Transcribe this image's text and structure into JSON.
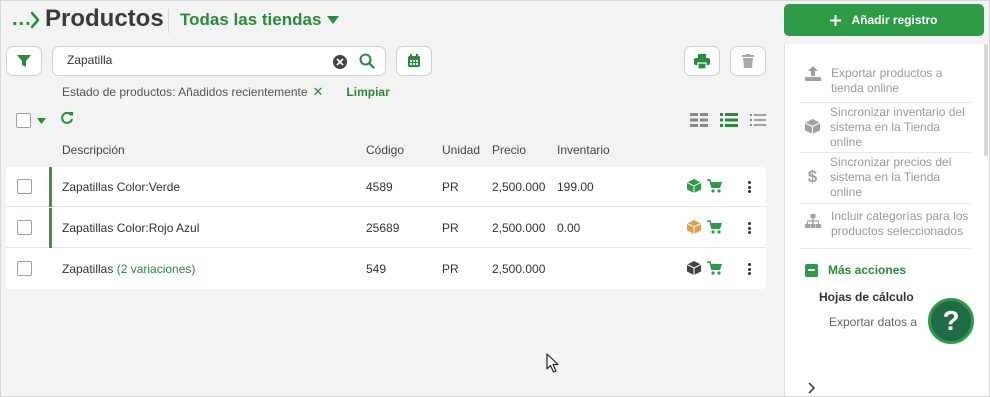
{
  "header": {
    "crumb_dots": "...",
    "title": "Productos",
    "store_selector": "Todas las tiendas"
  },
  "add_button": {
    "label": "Añadir registro"
  },
  "search": {
    "value": "Zapatilla",
    "placeholder": ""
  },
  "filter": {
    "text": "Estado de productos: Añadidos recientemente",
    "remove": "✕",
    "clear_label": "Limpiar"
  },
  "table": {
    "columns": [
      "Descripción",
      "Código",
      "Unidad",
      "Precio",
      "Inventario"
    ],
    "rows": [
      {
        "description": "Zapatillas Color:Verde",
        "variations": "",
        "code": "4589",
        "unit": "PR",
        "price": "2,500.000",
        "inventory": "199.00",
        "box_color": "#2e9b47"
      },
      {
        "description": "Zapatillas Color:Rojo Azul",
        "variations": "",
        "code": "25689",
        "unit": "PR",
        "price": "2,500.000",
        "inventory": "0.00",
        "box_color": "#e0a052"
      },
      {
        "description": "Zapatillas",
        "variations": "(2 variaciones)",
        "code": "549",
        "unit": "PR",
        "price": "2,500.000",
        "inventory": "",
        "box_color": "#444444"
      }
    ]
  },
  "panel": {
    "items": [
      {
        "label": "Exportar productos a tienda online",
        "icon": "upload-icon"
      },
      {
        "label": "Sincronizar inventario del sistema en la Tienda online",
        "icon": "box-icon"
      },
      {
        "label": "Sincronizar precios del sistema en la Tienda online",
        "icon": "dollar-icon"
      },
      {
        "label": "Incluir categorías para los productos seleccionados",
        "icon": "sitemap-icon"
      }
    ],
    "more_actions": "Más acciones",
    "spreadsheets": "Hojas de cálculo",
    "cut_item": "Exportar datos a"
  },
  "help": {
    "label": "?"
  },
  "colors": {
    "accent": "#2e9b47",
    "accent_text": "#2a8a3e"
  }
}
